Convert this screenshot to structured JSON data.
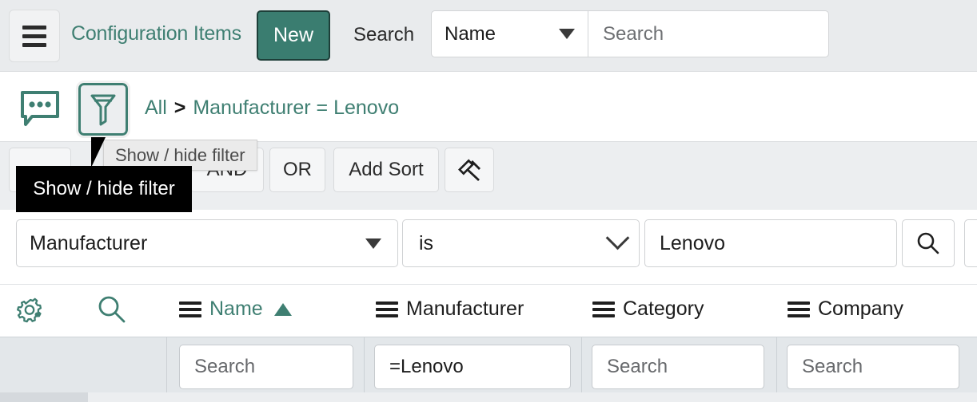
{
  "header": {
    "menu_icon": "hamburger-icon",
    "title": "Configuration Items",
    "new_label": "New",
    "search_label": "Search",
    "search_field_selected": "Name",
    "search_field_options": [
      "Name"
    ],
    "search_placeholder": "Search",
    "caret_icon": "caret-down-icon"
  },
  "breadcrumb": {
    "comment_icon": "comment-bubble-icon",
    "filter_icon": "funnel-filter-icon",
    "all_label": "All",
    "separator": ">",
    "condition_label": "Manufacturer = Lenovo"
  },
  "condition_toolbar": {
    "run_label": "",
    "and_label": "AND",
    "or_label": "OR",
    "add_sort_label": "Add Sort",
    "pin_icon": "gavel-pin-icon"
  },
  "tooltips": {
    "native_title": "Show / hide filter",
    "dark_tooltip": "Show / hide filter"
  },
  "filter_condition": {
    "field": "Manufacturer",
    "field_caret_icon": "caret-down-icon",
    "operator": "is",
    "operator_caret_icon": "chevron-down-icon",
    "value": "Lenovo",
    "search_icon": "magnifier-icon"
  },
  "table": {
    "gear_icon": "gear-settings-icon",
    "search_icon": "magnifier-icon",
    "columns": [
      {
        "label": "Name",
        "menu_icon": "column-menu-icon",
        "sorted": true,
        "sort_icon": "sort-ascending-icon"
      },
      {
        "label": "Manufacturer",
        "menu_icon": "column-menu-icon",
        "sorted": false,
        "sort_icon": ""
      },
      {
        "label": "Category",
        "menu_icon": "column-menu-icon",
        "sorted": false,
        "sort_icon": ""
      },
      {
        "label": "Company",
        "menu_icon": "column-menu-icon",
        "sorted": false,
        "sort_icon": ""
      }
    ],
    "filter_inputs": [
      {
        "value": "Search",
        "filled": false
      },
      {
        "value": "=Lenovo",
        "filled": true
      },
      {
        "value": "Search",
        "filled": false
      },
      {
        "value": "Search",
        "filled": false
      }
    ]
  },
  "colors": {
    "brand_teal": "#3f7f72",
    "new_button_bg": "#3a7d70",
    "header_bg": "#e9ebed",
    "toolbar_bg": "#eceef0",
    "table_filter_row_bg": "#e3e7ea",
    "tooltip_dark_bg": "#000000",
    "tooltip_native_bg": "#ebebeb"
  }
}
